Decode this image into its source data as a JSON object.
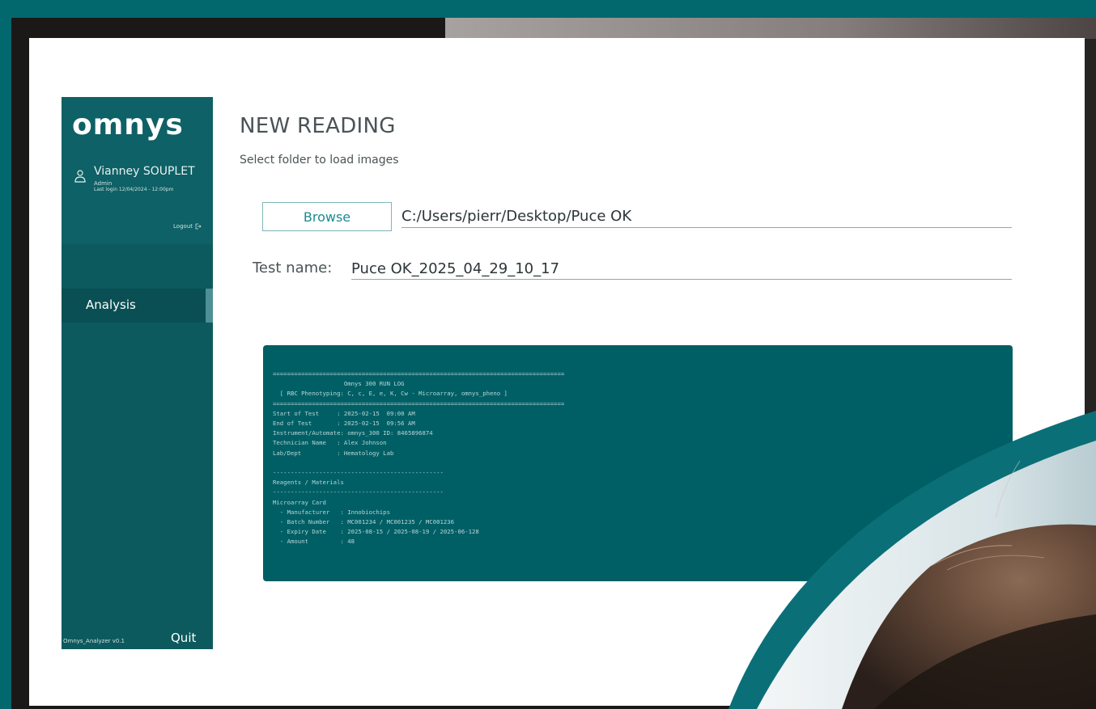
{
  "sidebar": {
    "logo": "omnys",
    "user": {
      "name": "Vianney SOUPLET",
      "role": "Admin",
      "last_login": "Last login 12/04/2024 - 12:00pm"
    },
    "logout_label": "Logout",
    "nav_items": [
      {
        "label": "Analysis",
        "active": true
      }
    ],
    "version": "Omnys_Analyzer v0.1",
    "quit_label": "Quit"
  },
  "main": {
    "title": "NEW READING",
    "subtitle": "Select folder to load images",
    "browse_label": "Browse",
    "folder_path": "C:/Users/pierr/Desktop/Puce OK",
    "test_name_label": "Test name:",
    "test_name_value": "Puce OK_2025_04_29_10_17",
    "run_log": "==================================================================================\n                    Omnys 300 RUN LOG\n  [ RBC Phenotyping: C, c, E, e, K, Cw - Microarray, omnys_pheno ]\n==================================================================================\nStart of Test     : 2025-02-15  09:00 AM\nEnd of Test       : 2025-02-15  09:56 AM\nInstrument/Automate: omnys_300 ID: 8465896874\nTechnician Name   : Alex Johnson\nLab/Dept          : Hematology Lab\n\n------------------------------------------------\nReagents / Materials\n------------------------------------------------\nMicroarray Card\n  - Manufacturer   : Innobiochips\n  - Batch Number   : MC001234 / MC001235 / MC001236\n  - Expiry Date    : 2025-08-15 / 2025-08-19 / 2025-06-128\n  - Amount         : 48"
  },
  "colors": {
    "brand_teal": "#0c5a5e",
    "accent": "#1c8a90",
    "log_background": "#005f65",
    "outer_background": "#03676e"
  }
}
